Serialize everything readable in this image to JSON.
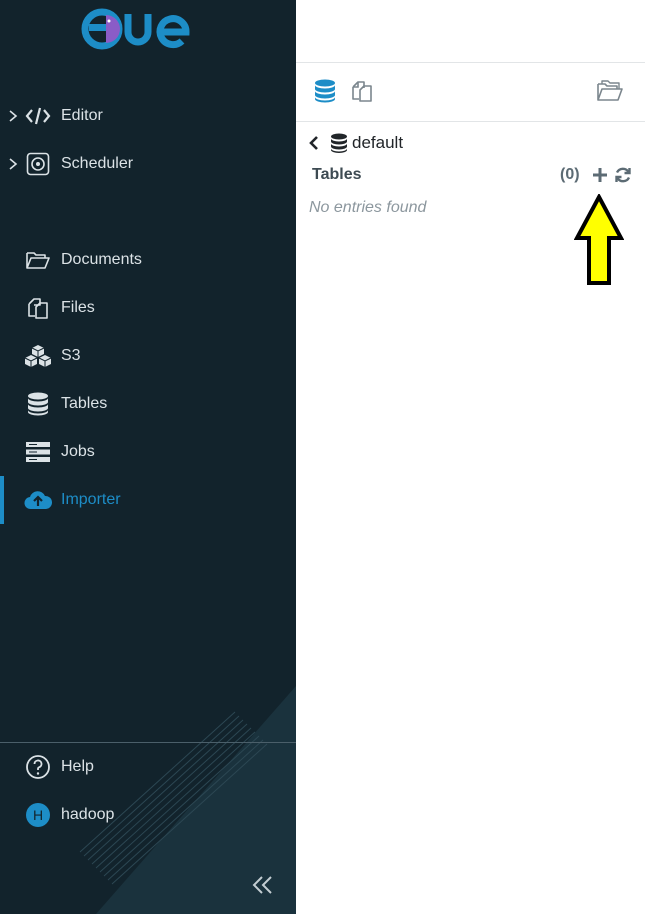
{
  "app": {
    "logo_text": "HUE"
  },
  "sidebar": {
    "primary": [
      {
        "label": "Editor",
        "icon": "code-icon"
      },
      {
        "label": "Scheduler",
        "icon": "scheduler-icon"
      }
    ],
    "items": [
      {
        "label": "Documents",
        "icon": "folder-open-icon"
      },
      {
        "label": "Files",
        "icon": "files-icon"
      },
      {
        "label": "S3",
        "icon": "cubes-icon"
      },
      {
        "label": "Tables",
        "icon": "database-icon"
      },
      {
        "label": "Jobs",
        "icon": "server-icon"
      },
      {
        "label": "Importer",
        "icon": "cloud-upload-icon",
        "active": true
      }
    ],
    "footer": {
      "help_label": "Help",
      "user_label": "hadoop",
      "user_initial": "H"
    }
  },
  "assist": {
    "database": "default",
    "section_title": "Tables",
    "count": "(0)",
    "empty_message": "No entries found"
  },
  "colors": {
    "sidebar_bg": "#12232c",
    "accent": "#1d8dc7",
    "annotation_arrow": "#ffff00"
  }
}
